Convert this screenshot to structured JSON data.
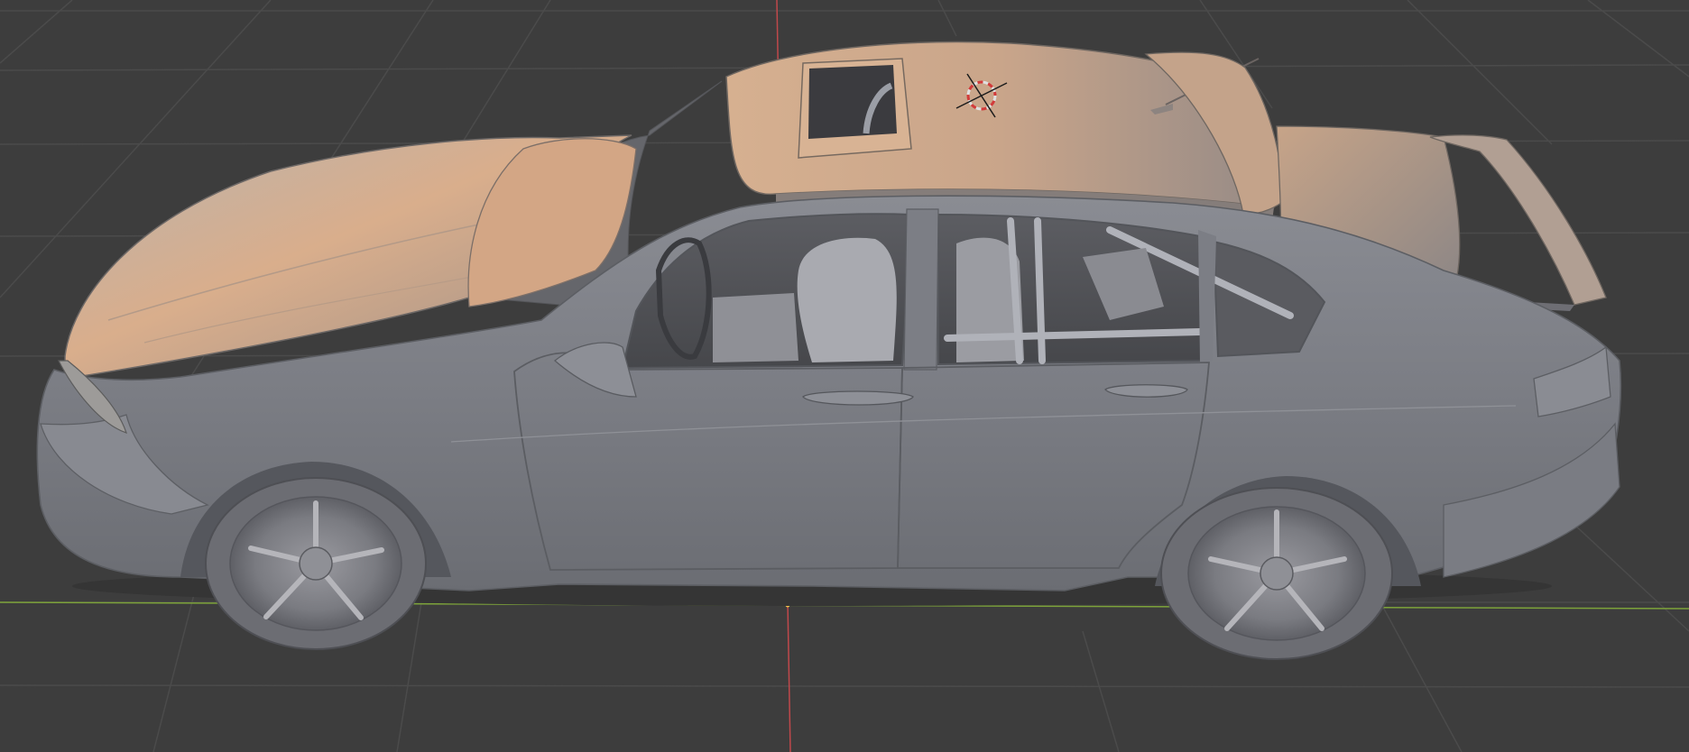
{
  "app": {
    "name": "3D Viewport",
    "view": "perspective"
  },
  "viewport": {
    "background_color": "#3d3d3d",
    "grid_color": "#4b4b4b",
    "x_axis_color": "#7da33a",
    "z_axis_color": "#c0484b"
  },
  "model": {
    "name": "sedan-car-model",
    "shading": "solid",
    "base_color": "#7d7f86",
    "highlight_color": "#c9a48a",
    "wheel_count": 2,
    "visible_doors": 2
  },
  "cursor": {
    "icon": "3d-cursor-icon",
    "ring_colors": [
      "#e0e0e0",
      "#d23a3a"
    ]
  }
}
